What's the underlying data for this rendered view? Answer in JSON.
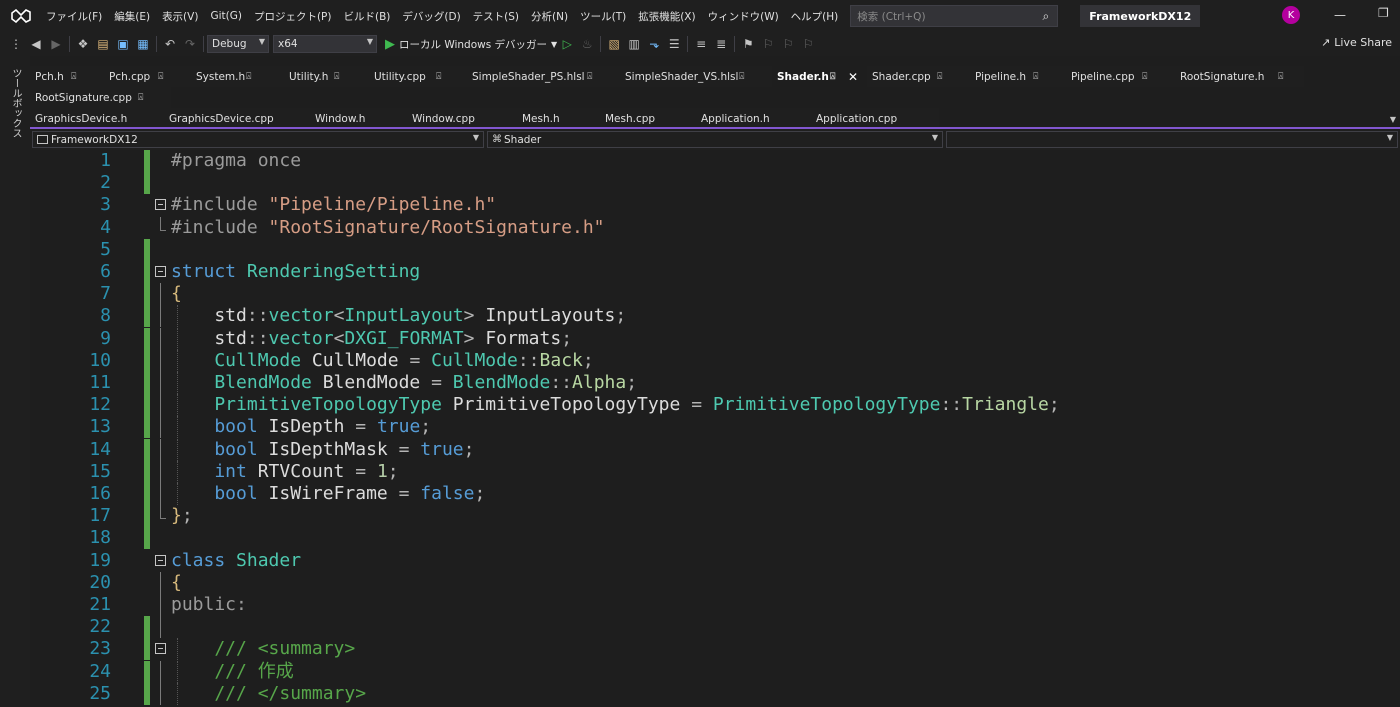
{
  "menu": {
    "logo": "VS",
    "items": [
      "ファイル(F)",
      "編集(E)",
      "表示(V)",
      "Git(G)",
      "プロジェクト(P)",
      "ビルド(B)",
      "デバッグ(D)",
      "テスト(S)",
      "分析(N)",
      "ツール(T)",
      "拡張機能(X)",
      "ウィンドウ(W)",
      "ヘルプ(H)"
    ],
    "search_placeholder": "検索 (Ctrl+Q)",
    "solution_name": "FrameworkDX12",
    "avatar_letter": "K"
  },
  "toolbar": {
    "configuration": "Debug",
    "platform": "x64",
    "run_label": "ローカル Windows デバッガー",
    "live_share": "Live Share"
  },
  "toolbox_label": "ツールボックス",
  "tabs_row1": [
    {
      "label": "Pch.h",
      "active": false
    },
    {
      "label": "Pch.cpp",
      "active": false
    },
    {
      "label": "System.h",
      "active": false
    },
    {
      "label": "Utility.h",
      "active": false
    },
    {
      "label": "Utility.cpp",
      "active": false
    },
    {
      "label": "SimpleShader_PS.hlsl",
      "active": false
    },
    {
      "label": "SimpleShader_VS.hlsl",
      "active": false
    },
    {
      "label": "Shader.h",
      "active": true
    },
    {
      "label": "Shader.cpp",
      "active": false
    },
    {
      "label": "Pipeline.h",
      "active": false
    },
    {
      "label": "Pipeline.cpp",
      "active": false
    },
    {
      "label": "RootSignature.h",
      "active": false
    }
  ],
  "tabs_row2": [
    {
      "label": "RootSignature.cpp"
    }
  ],
  "tabs_row3": [
    {
      "label": "GraphicsDevice.h"
    },
    {
      "label": "GraphicsDevice.cpp"
    },
    {
      "label": "Window.h"
    },
    {
      "label": "Window.cpp"
    },
    {
      "label": "Mesh.h"
    },
    {
      "label": "Mesh.cpp"
    },
    {
      "label": "Application.h"
    },
    {
      "label": "Application.cpp"
    }
  ],
  "navbar": {
    "project": "FrameworkDX12",
    "scope": "Shader",
    "member": ""
  },
  "editor": {
    "lines": [
      {
        "n": "1",
        "segs": [
          [
            "pp",
            "#pragma once"
          ]
        ]
      },
      {
        "n": "2",
        "segs": []
      },
      {
        "n": "3",
        "segs": [
          [
            "pp",
            "#include "
          ],
          [
            "str",
            "\"Pipeline/Pipeline.h\""
          ]
        ]
      },
      {
        "n": "4",
        "segs": [
          [
            "pp",
            "#include "
          ],
          [
            "str",
            "\"RootSignature/RootSignature.h\""
          ]
        ]
      },
      {
        "n": "5",
        "segs": []
      },
      {
        "n": "6",
        "segs": [
          [
            "kw",
            "struct "
          ],
          [
            "ty",
            "RenderingSetting"
          ]
        ]
      },
      {
        "n": "7",
        "segs": [
          [
            "br",
            "{"
          ]
        ]
      },
      {
        "n": "8",
        "segs": [
          [
            "tx",
            "    std"
          ],
          [
            "pu",
            "::"
          ],
          [
            "ty",
            "vector"
          ],
          [
            "pu",
            "<"
          ],
          [
            "ty",
            "InputLayout"
          ],
          [
            "pu",
            "> "
          ],
          [
            "tx",
            "InputLayouts"
          ],
          [
            "pu",
            ";"
          ]
        ]
      },
      {
        "n": "9",
        "segs": [
          [
            "tx",
            "    std"
          ],
          [
            "pu",
            "::"
          ],
          [
            "ty",
            "vector"
          ],
          [
            "pu",
            "<"
          ],
          [
            "ty",
            "DXGI_FORMAT"
          ],
          [
            "pu",
            "> "
          ],
          [
            "tx",
            "Formats"
          ],
          [
            "pu",
            ";"
          ]
        ]
      },
      {
        "n": "10",
        "segs": [
          [
            "ty",
            "    CullMode "
          ],
          [
            "tx",
            "CullMode "
          ],
          [
            "pu",
            "= "
          ],
          [
            "ty",
            "CullMode"
          ],
          [
            "pu",
            "::"
          ],
          [
            "en",
            "Back"
          ],
          [
            "pu",
            ";"
          ]
        ]
      },
      {
        "n": "11",
        "segs": [
          [
            "ty",
            "    BlendMode "
          ],
          [
            "tx",
            "BlendMode "
          ],
          [
            "pu",
            "= "
          ],
          [
            "ty",
            "BlendMode"
          ],
          [
            "pu",
            "::"
          ],
          [
            "en",
            "Alpha"
          ],
          [
            "pu",
            ";"
          ]
        ]
      },
      {
        "n": "12",
        "segs": [
          [
            "ty",
            "    PrimitiveTopologyType "
          ],
          [
            "tx",
            "PrimitiveTopologyType "
          ],
          [
            "pu",
            "= "
          ],
          [
            "ty",
            "PrimitiveTopologyType"
          ],
          [
            "pu",
            "::"
          ],
          [
            "en",
            "Triangle"
          ],
          [
            "pu",
            ";"
          ]
        ]
      },
      {
        "n": "13",
        "segs": [
          [
            "kw",
            "    bool "
          ],
          [
            "tx",
            "IsDepth "
          ],
          [
            "pu",
            "= "
          ],
          [
            "kw",
            "true"
          ],
          [
            "pu",
            ";"
          ]
        ]
      },
      {
        "n": "14",
        "segs": [
          [
            "kw",
            "    bool "
          ],
          [
            "tx",
            "IsDepthMask "
          ],
          [
            "pu",
            "= "
          ],
          [
            "kw",
            "true"
          ],
          [
            "pu",
            ";"
          ]
        ]
      },
      {
        "n": "15",
        "segs": [
          [
            "kw",
            "    int "
          ],
          [
            "tx",
            "RTVCount "
          ],
          [
            "pu",
            "= "
          ],
          [
            "num",
            "1"
          ],
          [
            "pu",
            ";"
          ]
        ]
      },
      {
        "n": "16",
        "segs": [
          [
            "kw",
            "    bool "
          ],
          [
            "tx",
            "IsWireFrame "
          ],
          [
            "pu",
            "= "
          ],
          [
            "kw",
            "false"
          ],
          [
            "pu",
            ";"
          ]
        ]
      },
      {
        "n": "17",
        "segs": [
          [
            "br",
            "}"
          ],
          [
            "pu",
            ";"
          ]
        ]
      },
      {
        "n": "18",
        "segs": []
      },
      {
        "n": "19",
        "segs": [
          [
            "kw",
            "class "
          ],
          [
            "ty",
            "Shader"
          ]
        ]
      },
      {
        "n": "20",
        "segs": [
          [
            "br",
            "{"
          ]
        ]
      },
      {
        "n": "21",
        "segs": [
          [
            "pp",
            "public:"
          ]
        ]
      },
      {
        "n": "22",
        "segs": []
      },
      {
        "n": "23",
        "segs": [
          [
            "cm",
            "    /// <summary>"
          ]
        ]
      },
      {
        "n": "24",
        "segs": [
          [
            "cm",
            "    /// 作成"
          ]
        ]
      },
      {
        "n": "25",
        "segs": [
          [
            "cm",
            "    /// </summary>"
          ]
        ]
      }
    ]
  }
}
